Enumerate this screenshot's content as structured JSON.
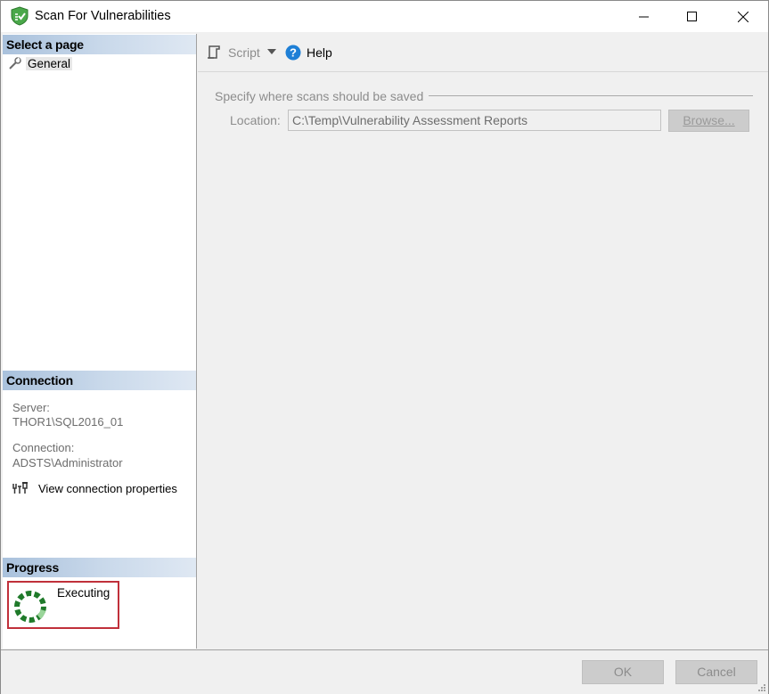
{
  "window": {
    "title": "Scan For Vulnerabilities",
    "controls": [
      "minimize-icon",
      "maximize-icon",
      "close-icon"
    ]
  },
  "left_panel": {
    "select_page_header": "Select a page",
    "pages": [
      {
        "label": "General",
        "icon": "wrench-icon"
      }
    ],
    "connection_header": "Connection",
    "server_label": "Server:",
    "server_value": "THOR1\\SQL2016_01",
    "connection_label": "Connection:",
    "connection_value": "ADSTS\\Administrator",
    "view_connection_link": "View connection properties",
    "progress_header": "Progress",
    "progress_status": "Executing"
  },
  "toolbar": {
    "script_label": "Script",
    "help_label": "Help"
  },
  "main": {
    "group_label": "Specify where scans should be saved",
    "location_label": "Location:",
    "location_value": "C:\\Temp\\Vulnerability Assessment Reports",
    "browse_label": "Browse..."
  },
  "footer": {
    "ok_label": "OK",
    "cancel_label": "Cancel"
  },
  "colors": {
    "section_header": "#b9cde3",
    "progress_highlight": "#c0303a",
    "spinner_green": "#2e9e3a",
    "help_blue": "#1e7fd6"
  }
}
